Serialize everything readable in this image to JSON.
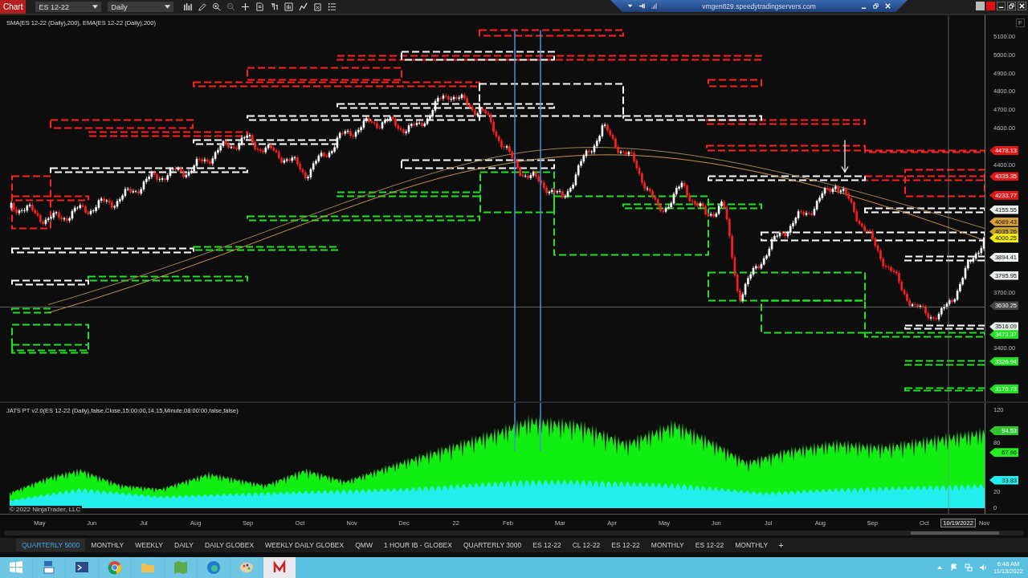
{
  "toolbar": {
    "app_label": "Chart",
    "instrument": "ES 12-22",
    "interval": "Daily"
  },
  "remote_bar": {
    "host": "vmgen829.speedytradingservers.com"
  },
  "price_panel": {
    "legend": "SMA(ES 12-22 (Daily),200), EMA(ES 12-22 (Daily),200)",
    "corner_label": "F",
    "axis_ticks": [
      "5100.00",
      "5000.00",
      "4900.00",
      "4800.00",
      "4700.00",
      "4600.00",
      "4400.00",
      "3700.00",
      "3400.00"
    ],
    "markers": [
      {
        "value": "4478.13",
        "color": "#e01818"
      },
      {
        "value": "4335.35",
        "color": "#e01818"
      },
      {
        "value": "4233.77",
        "color": "#e01818"
      },
      {
        "value": "4155.55",
        "color": "#eef2ee"
      },
      {
        "value": "4089.43",
        "color": "#d7a13a"
      },
      {
        "value": "4035.26",
        "color": "#c9a230"
      },
      {
        "value": "4000.25",
        "color": "#f2ea10"
      },
      {
        "value": "3894.41",
        "color": "#eef2ee"
      },
      {
        "value": "3795.95",
        "color": "#eef2ee"
      },
      {
        "value": "3630.25",
        "color": "#444444"
      },
      {
        "value": "3516.09",
        "color": "#eef2ee"
      },
      {
        "value": "3473.37",
        "color": "#22e022"
      },
      {
        "value": "3326.94",
        "color": "#22e022"
      },
      {
        "value": "3176.73",
        "color": "#22e022"
      }
    ]
  },
  "indicator_panel": {
    "legend": "JATS PT v2.0(ES 12-22 (Daily),false,Close,15:00:00,14,15,Minute,08:00:00,false,false)",
    "copyright": "© 2022 NinjaTrader, LLC",
    "axis_ticks": [
      "120",
      "80",
      "20",
      "0"
    ],
    "markers": [
      {
        "value": "94.53",
        "color": "#33c433"
      },
      {
        "value": "67.66",
        "color": "#22f022"
      },
      {
        "value": "33.83",
        "color": "#22eeee"
      }
    ]
  },
  "time_axis": {
    "labels": [
      "May",
      "Jun",
      "Jul",
      "Aug",
      "Sep",
      "Oct",
      "Nov",
      "Dec",
      "22",
      "Feb",
      "Mar",
      "Apr",
      "May",
      "Jun",
      "Jul",
      "Aug",
      "Sep",
      "Oct",
      "Nov"
    ],
    "cursor_label": "10/19/2022"
  },
  "tabs": [
    {
      "label": "QUARTERLY 5000",
      "selected": true
    },
    {
      "label": "MONTHLY",
      "selected": false
    },
    {
      "label": "WEEKLY",
      "selected": false
    },
    {
      "label": "DAILY",
      "selected": false
    },
    {
      "label": "DAILY GLOBEX",
      "selected": false
    },
    {
      "label": "WEEKLY DAILY GLOBEX",
      "selected": false
    },
    {
      "label": "QMW",
      "selected": false
    },
    {
      "label": "1 HOUR IB - GLOBEX",
      "selected": false
    },
    {
      "label": "QUARTERLY 3000",
      "selected": false
    },
    {
      "label": "ES 12-22",
      "selected": false
    },
    {
      "label": "CL 12-22",
      "selected": false
    },
    {
      "label": "ES 12-22",
      "selected": false
    },
    {
      "label": "MONTHLY",
      "selected": false
    },
    {
      "label": "ES 12-22",
      "selected": false
    },
    {
      "label": "MONTHLY",
      "selected": false
    }
  ],
  "add_tab": "+",
  "taskbar": {
    "time": "6:48 AM",
    "date": "11/13/2022"
  }
}
